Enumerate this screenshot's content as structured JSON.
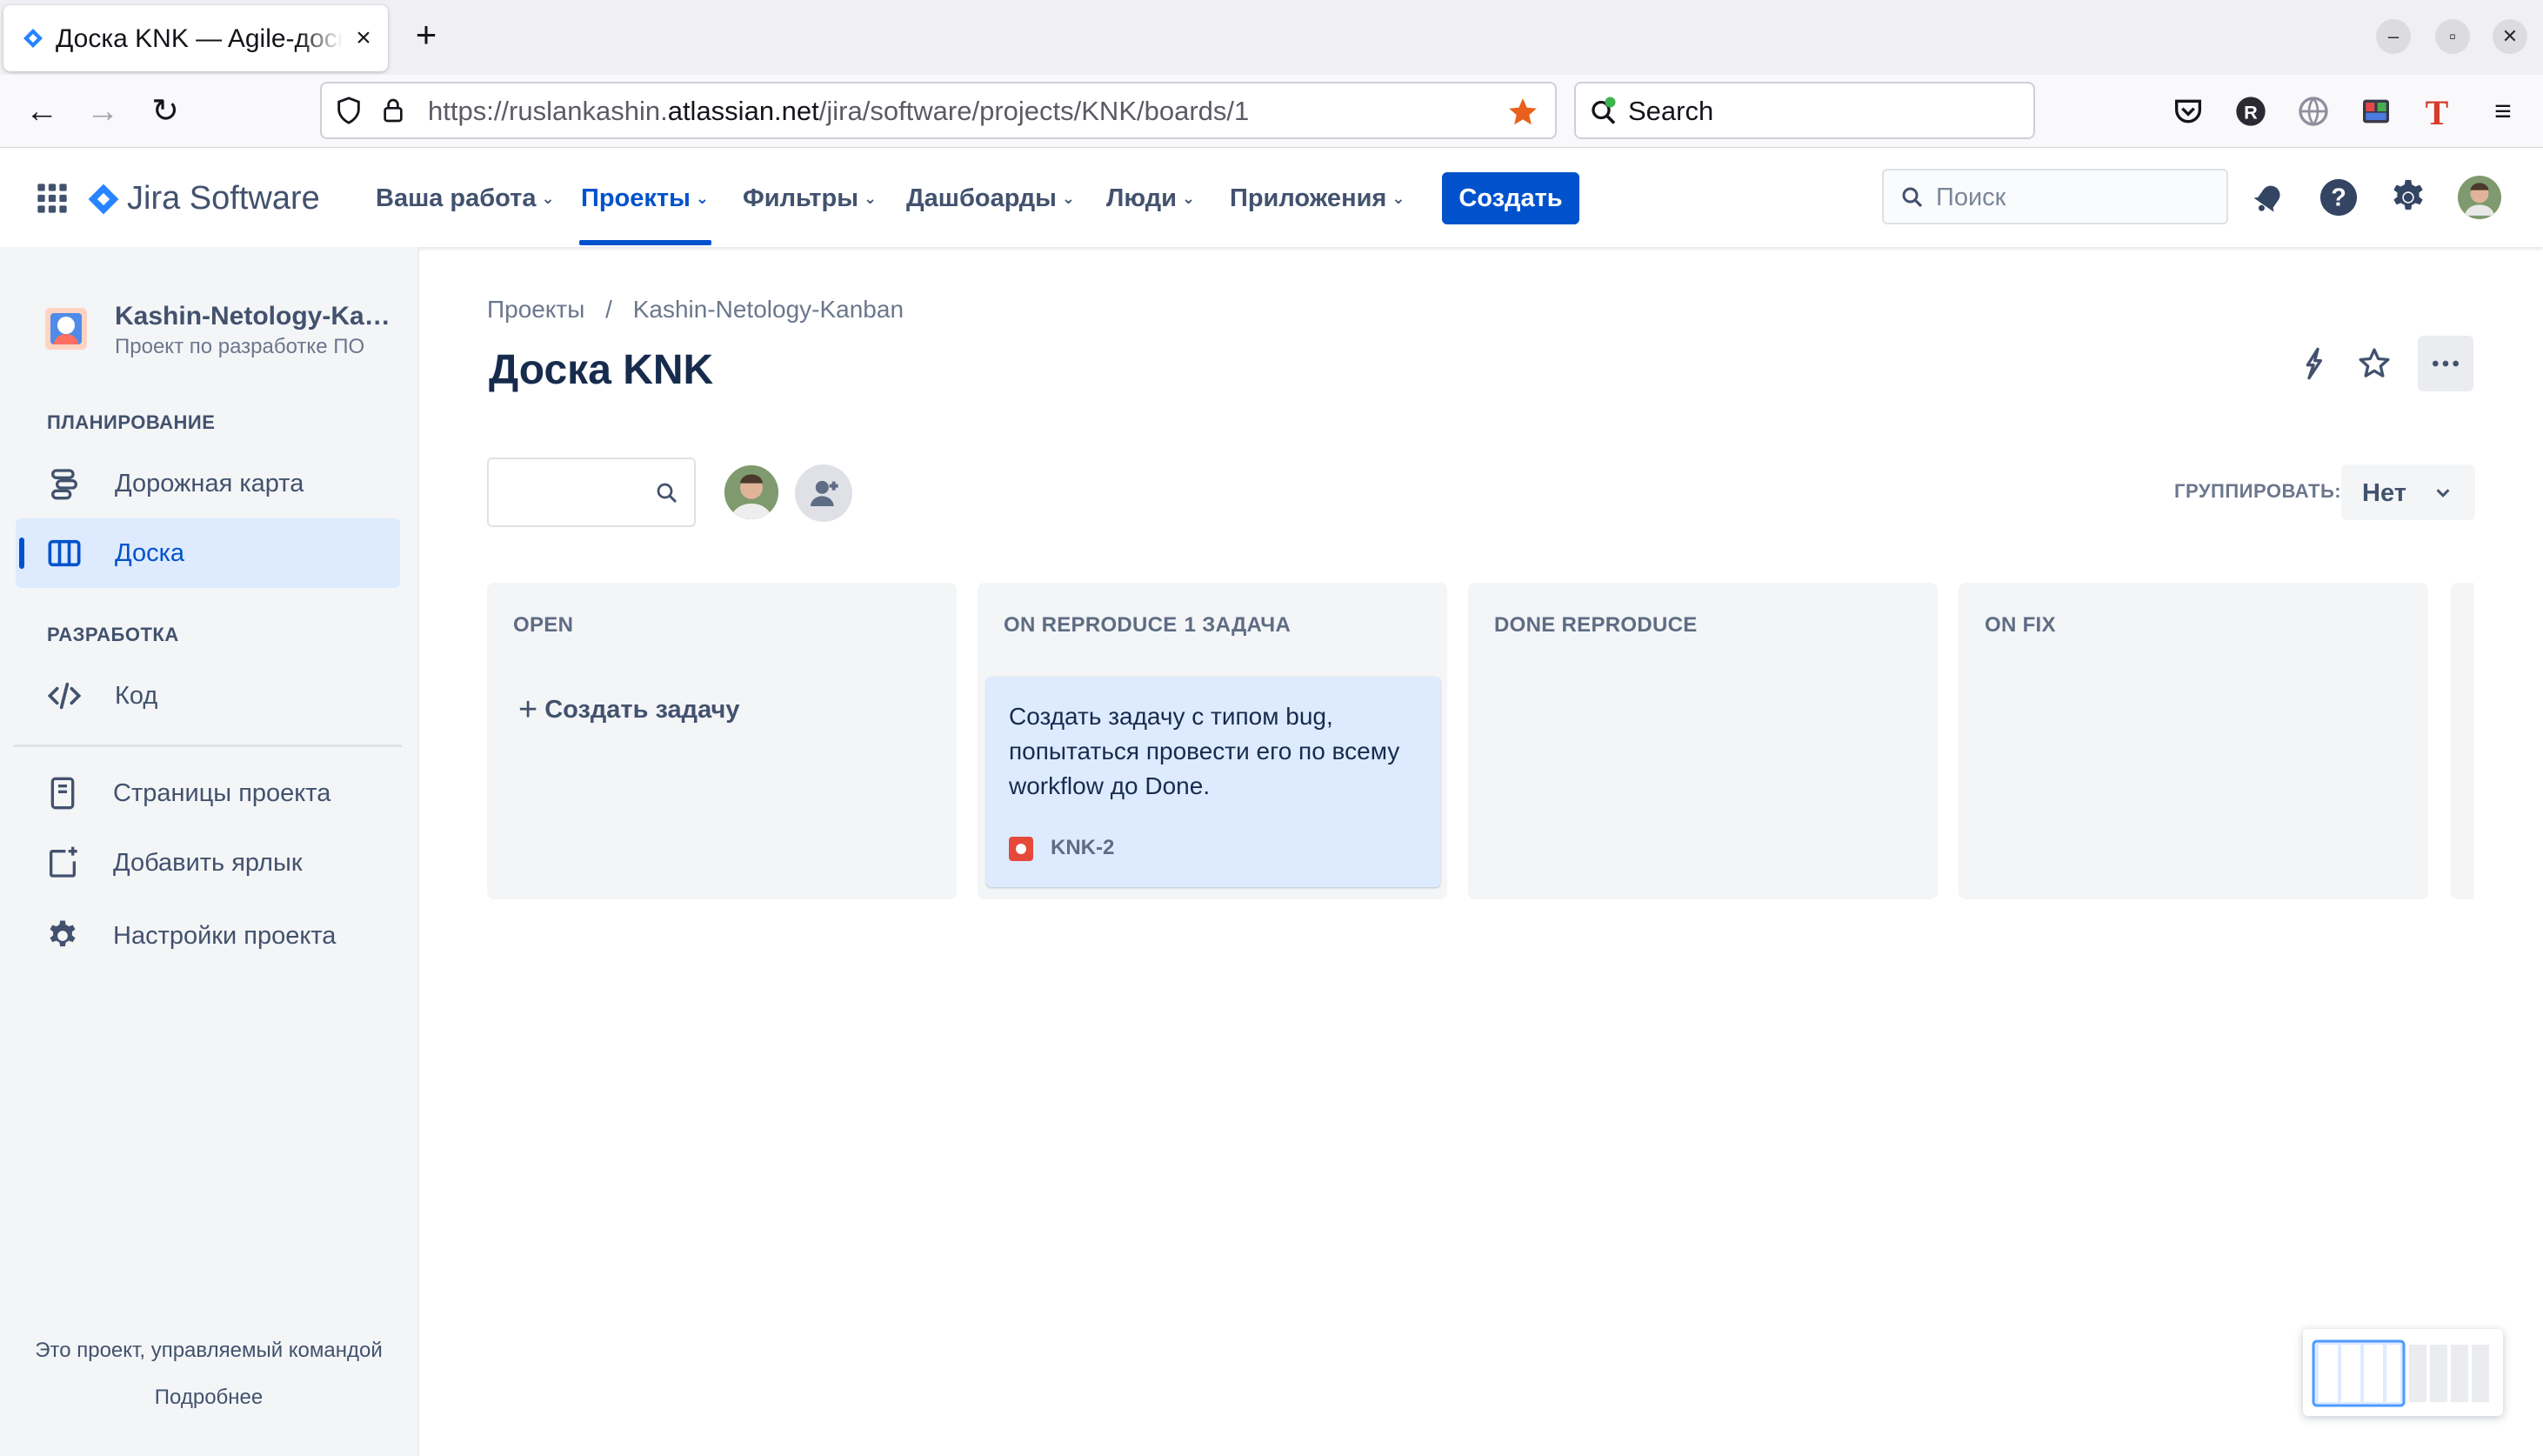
{
  "browser": {
    "tab_title": "Доска KNK — Agile-доска",
    "tab_close_glyph": "×",
    "new_tab_glyph": "+",
    "window_controls": [
      "–",
      "▫",
      "✕"
    ],
    "url_prefix": "https://ruslankashin.",
    "url_domain": "atlassian.net",
    "url_suffix": "/jira/software/projects/KNK/boards/1",
    "search_label": "Search",
    "bookmark_color": "#e8601c"
  },
  "jira": {
    "product_name": "Jira Software",
    "menu": [
      {
        "label": "Ваша работа"
      },
      {
        "label": "Проекты"
      },
      {
        "label": "Фильтры"
      },
      {
        "label": "Дашбоарды"
      },
      {
        "label": "Люди"
      },
      {
        "label": "Приложения"
      }
    ],
    "create_label": "Создать",
    "search_placeholder": "Поиск",
    "accent": "#0052cc"
  },
  "sidebar": {
    "project_name": "Kashin-Netology-Kanban",
    "project_type": "Проект по разработке ПО",
    "planning_heading": "ПЛАНИРОВАНИЕ",
    "planning_items": [
      {
        "label": "Дорожная карта",
        "icon": "roadmap-icon"
      },
      {
        "label": "Доска",
        "icon": "board-icon",
        "active": true
      }
    ],
    "dev_heading": "РАЗРАБОТКА",
    "dev_items": [
      {
        "label": "Код",
        "icon": "code-icon"
      }
    ],
    "extra_items": [
      {
        "label": "Страницы проекта",
        "icon": "pages-icon"
      },
      {
        "label": "Добавить ярлык",
        "icon": "add-shortcut-icon"
      },
      {
        "label": "Настройки проекта",
        "icon": "settings-icon"
      }
    ],
    "footer_text": "Это проект, управляемый командой",
    "footer_link": "Подробнее"
  },
  "board": {
    "breadcrumb_root": "Проекты",
    "breadcrumb_sep": "/",
    "breadcrumb_project": "Kashin-Netology-Kanban",
    "title": "Доска KNK",
    "group_label": "ГРУППИРОВАТЬ:",
    "group_value": "Нет",
    "columns": [
      {
        "title": "OPEN",
        "count": "",
        "create_label": "Создать задачу"
      },
      {
        "title": "ON REPRODUCE",
        "count": "1 ЗАДАЧА"
      },
      {
        "title": "DONE REPRODUCE",
        "count": ""
      },
      {
        "title": "ON FIX",
        "count": ""
      }
    ],
    "card": {
      "summary": "Создать задачу с типом bug, попытаться провести его по всему workflow до Done.",
      "key": "KNK-2",
      "type_icon": "bug-icon",
      "type_color": "#e5493a"
    }
  }
}
